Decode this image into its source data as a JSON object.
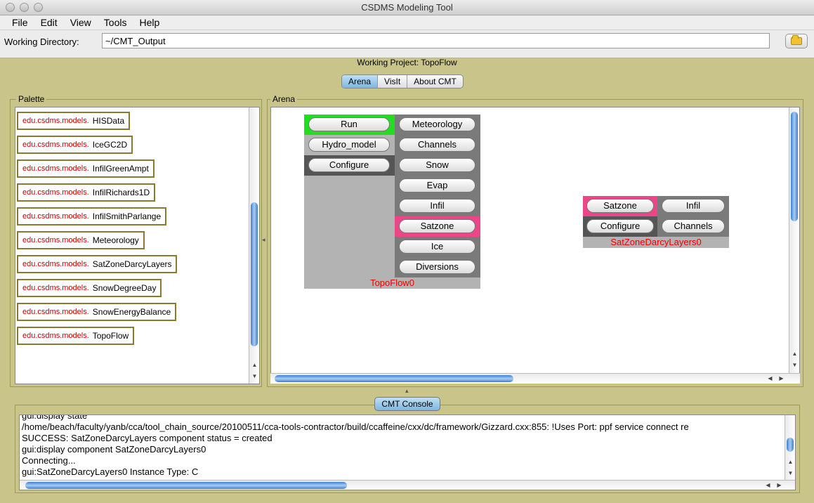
{
  "window": {
    "title": "CSDMS Modeling Tool"
  },
  "menu": [
    "File",
    "Edit",
    "View",
    "Tools",
    "Help"
  ],
  "working_directory": {
    "label": "Working Directory:",
    "value": "~/CMT_Output"
  },
  "project": {
    "label": "Working Project: TopoFlow"
  },
  "tabs": [
    "Arena",
    "VisIt",
    "About CMT"
  ],
  "palette": {
    "title": "Palette",
    "package": "edu.csdms.models.",
    "items": [
      "HISData",
      "IceGC2D",
      "InfilGreenAmpt",
      "InfilRichards1D",
      "InfilSmithParlange",
      "Meteorology",
      "SatZoneDarcyLayers",
      "SnowDegreeDay",
      "SnowEnergyBalance",
      "TopoFlow"
    ]
  },
  "arena": {
    "title": "Arena",
    "components": [
      {
        "name": "TopoFlow0",
        "left_buttons": [
          "Run",
          "Hydro_model",
          "Configure"
        ],
        "right_buttons": [
          "Meteorology",
          "Channels",
          "Snow",
          "Evap",
          "Infil",
          "Satzone",
          "Ice",
          "Diversions"
        ]
      },
      {
        "name": "SatZoneDarcyLayers0",
        "left_buttons": [
          "Satzone",
          "Configure"
        ],
        "right_buttons": [
          "Infil",
          "Channels"
        ]
      }
    ]
  },
  "console": {
    "title": "CMT Console",
    "lines": [
      "gui:display state",
      "/home/beach/faculty/yanb/cca/tool_chain_source/20100511/cca-tools-contractor/build/ccaffeine/cxx/dc/framework/Gizzard.cxx:855: !Uses Port: ppf service connect re",
      "SUCCESS: SatZoneDarcyLayers component status = created",
      "gui:display component SatZoneDarcyLayers0",
      "Connecting...",
      "gui:SatZoneDarcyLayers0 Instance Type: C"
    ]
  },
  "colors": {
    "run_port": "#22dd22",
    "provides_port": "#ee4488",
    "uses_bg": "#7a7a7a",
    "config_bg": "#555555",
    "body_bg": "#b3b3b3",
    "component_label": "#ee0000"
  }
}
